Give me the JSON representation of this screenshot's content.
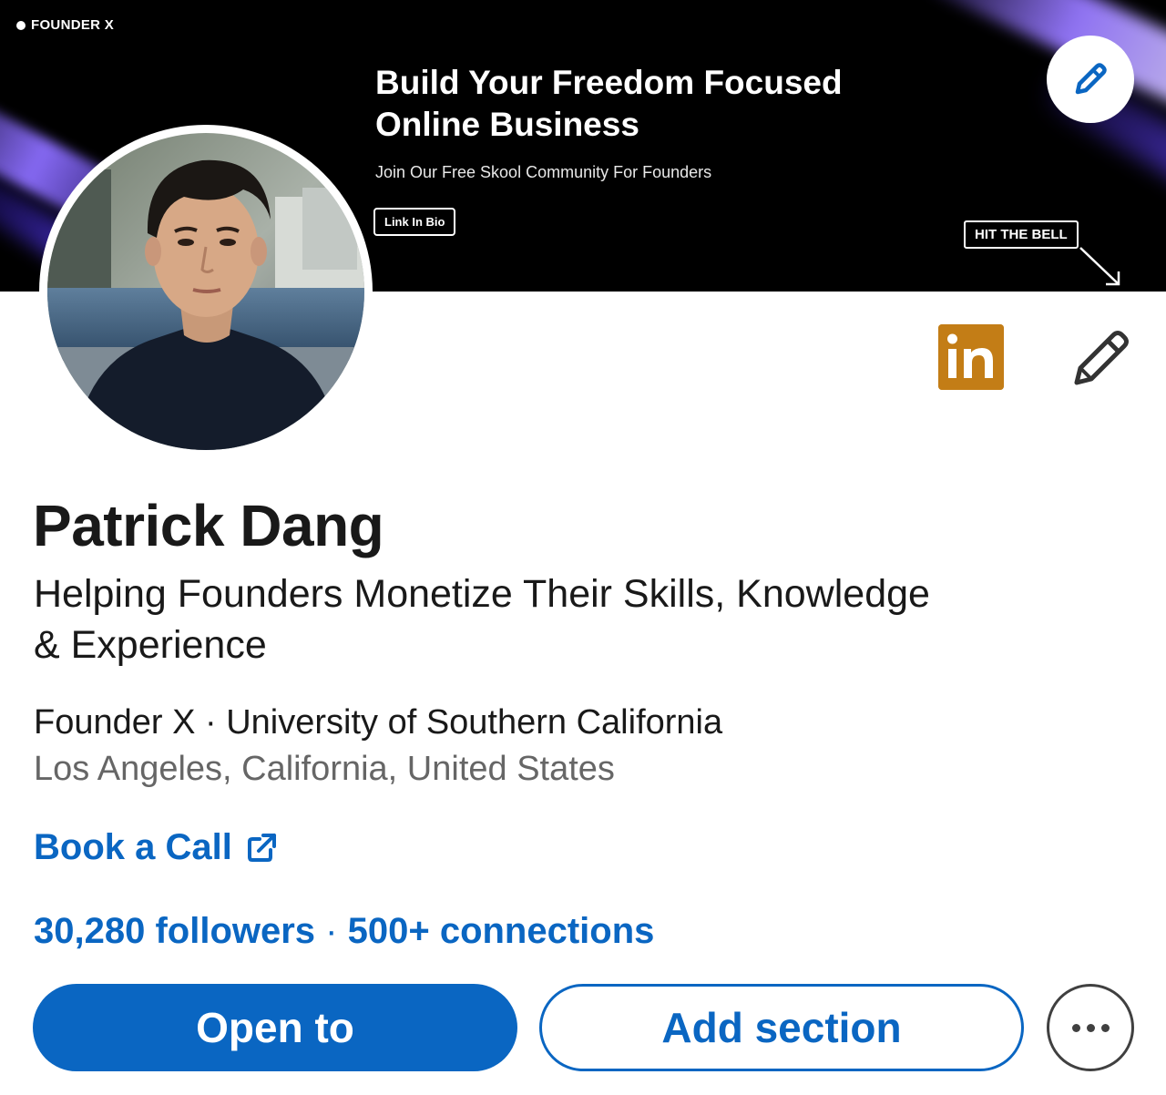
{
  "banner": {
    "brand": "FOUNDER X",
    "title_line1": "Build Your Freedom Focused",
    "title_line2": "Online Business",
    "subtitle": "Join Our Free Skool Community For Founders",
    "link_bio": "Link In Bio",
    "hit_bell": "HIT THE BELL",
    "edit_icon": "pencil-icon"
  },
  "profile": {
    "name": "Patrick Dang",
    "headline_line1": "Helping Founders Monetize Their Skills, Knowledge",
    "headline_line2": "& Experience",
    "org": "Founder X · University of Southern California",
    "location": "Los Angeles, California, United States",
    "book_call": "Book a Call",
    "followers": "30,280 followers",
    "separator": "·",
    "connections": "500+ connections"
  },
  "actions": {
    "open_to": "Open to",
    "add_section": "Add section",
    "more_icon": "ellipsis-icon"
  },
  "icons": {
    "linkedin_badge": "in",
    "edit_profile": "pencil-icon",
    "external_link": "external-link-icon"
  },
  "colors": {
    "accent": "#0a66c2",
    "linkedin_badge": "#c37d16",
    "banner_bg": "#000000",
    "secondary_text": "#666666"
  }
}
